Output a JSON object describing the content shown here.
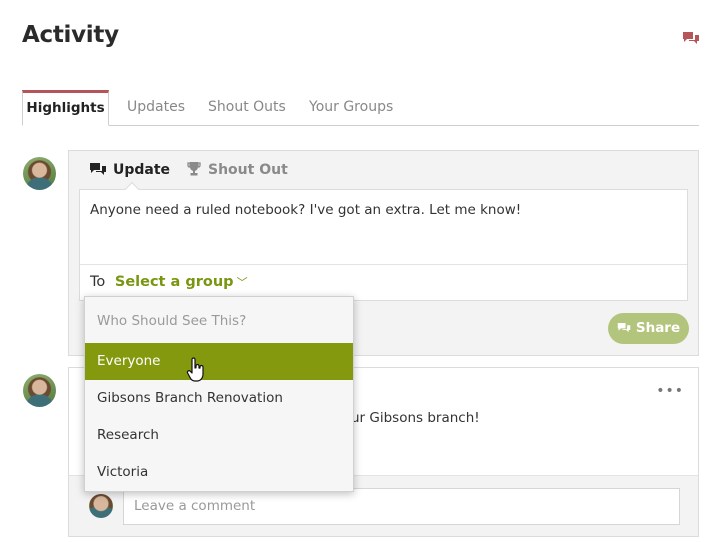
{
  "header": {
    "title": "Activity",
    "chat_icon": "chat-bubbles-icon"
  },
  "tabs": [
    {
      "label": "Highlights",
      "active": true
    },
    {
      "label": "Updates"
    },
    {
      "label": "Shout Outs"
    },
    {
      "label": "Your Groups"
    }
  ],
  "composer": {
    "tab_update": "Update",
    "tab_shout": "Shout Out",
    "text": "Anyone need a ruled notebook? I've got an extra. Let me know!",
    "to_label": "To",
    "group_select": "Select a group",
    "share_label": "Share"
  },
  "dropdown": {
    "header": "Who Should See This?",
    "items": [
      "Everyone",
      "Gibsons Branch Renovation",
      "Research",
      "Victoria"
    ],
    "selected": "Everyone"
  },
  "post": {
    "more": "•••",
    "text_visible": "ur Gibsons branch!",
    "comment_placeholder": "Leave a comment"
  },
  "colors": {
    "accent_green": "#85990f",
    "tab_accent": "#b5555a",
    "share_bg": "#b3c57c"
  }
}
